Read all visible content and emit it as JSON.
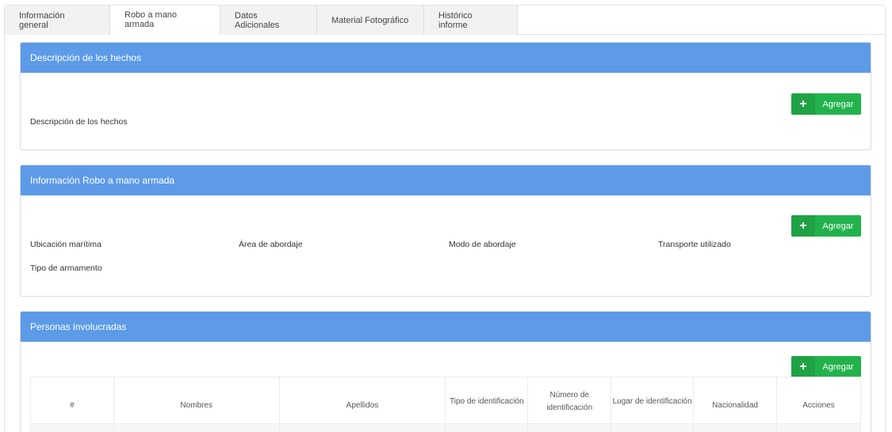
{
  "tabs": [
    {
      "label": "Información general"
    },
    {
      "label": "Robo a mano armada"
    },
    {
      "label": "Datos Adicionales"
    },
    {
      "label": "Material Fotográfico"
    },
    {
      "label": "Histórico informe"
    }
  ],
  "panel_hechos": {
    "title": "Descripción de los hechos",
    "add_label": "Agregar",
    "fields": [
      "Descripción de los hechos"
    ]
  },
  "panel_robo": {
    "title": "Información Robo a mano armada",
    "add_label": "Agregar",
    "fields": [
      "Ubicación marítima",
      "Área de abordaje",
      "Modo de abordaje",
      "Transporte utilizado",
      "Tipo de armamento"
    ]
  },
  "panel_personas": {
    "title": "Personas involucradas",
    "add_label": "Agregar",
    "columns": [
      "#",
      "Nombres",
      "Apellidos",
      "Tipo de identificación",
      "Número de identificación",
      "Lugar de identificación",
      "Nacionalidad",
      "Acciones"
    ]
  },
  "colors": {
    "header_blue": "#5d9be8",
    "add_green": "#22b24c"
  },
  "icons": {
    "add": "plus-icon"
  }
}
